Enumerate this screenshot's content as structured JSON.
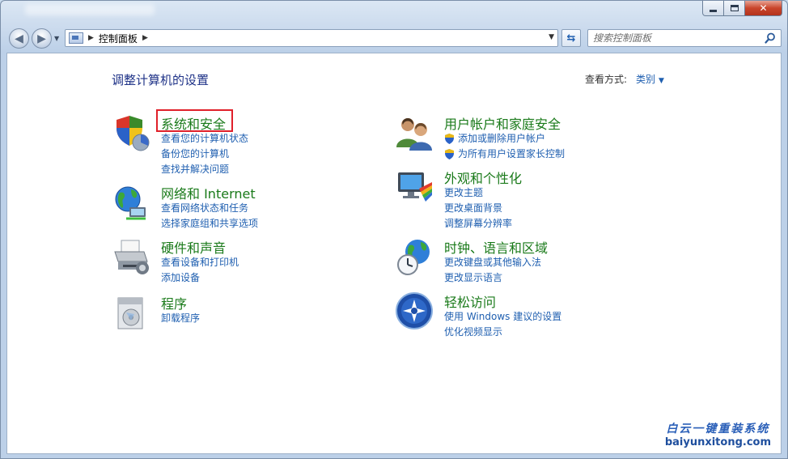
{
  "nav": {
    "breadcrumb": "控制面板",
    "search_placeholder": "搜索控制面板"
  },
  "header": {
    "title": "调整计算机的设置",
    "view_by_label": "查看方式:",
    "view_by_value": "类别"
  },
  "categories": [
    {
      "title": "系统和安全",
      "icon": "shield-icon",
      "links": [
        "查看您的计算机状态",
        "备份您的计算机",
        "查找并解决问题"
      ]
    },
    {
      "title": "网络和 Internet",
      "icon": "network-icon",
      "links": [
        "查看网络状态和任务",
        "选择家庭组和共享选项"
      ]
    },
    {
      "title": "硬件和声音",
      "icon": "printer-icon",
      "links": [
        "查看设备和打印机",
        "添加设备"
      ]
    },
    {
      "title": "程序",
      "icon": "programs-icon",
      "links": [
        "卸载程序"
      ]
    },
    {
      "title": "用户帐户和家庭安全",
      "icon": "users-icon",
      "links": [
        "添加或删除用户帐户",
        "为所有用户设置家长控制"
      ]
    },
    {
      "title": "外观和个性化",
      "icon": "appearance-icon",
      "links": [
        "更改主题",
        "更改桌面背景",
        "调整屏幕分辨率"
      ]
    },
    {
      "title": "时钟、语言和区域",
      "icon": "clock-globe-icon",
      "links": [
        "更改键盘或其他输入法",
        "更改显示语言"
      ]
    },
    {
      "title": "轻松访问",
      "icon": "ease-of-access-icon",
      "links": [
        "使用 Windows 建议的设置",
        "优化视频显示"
      ]
    }
  ],
  "watermark": {
    "line1": "白云一键重装系统",
    "line2": "baiyunxitong.com"
  },
  "colors": {
    "link": "#1f5fb0",
    "category_title": "#1a7a1a",
    "page_title": "#1e3287",
    "highlight_border": "#e0202a"
  }
}
